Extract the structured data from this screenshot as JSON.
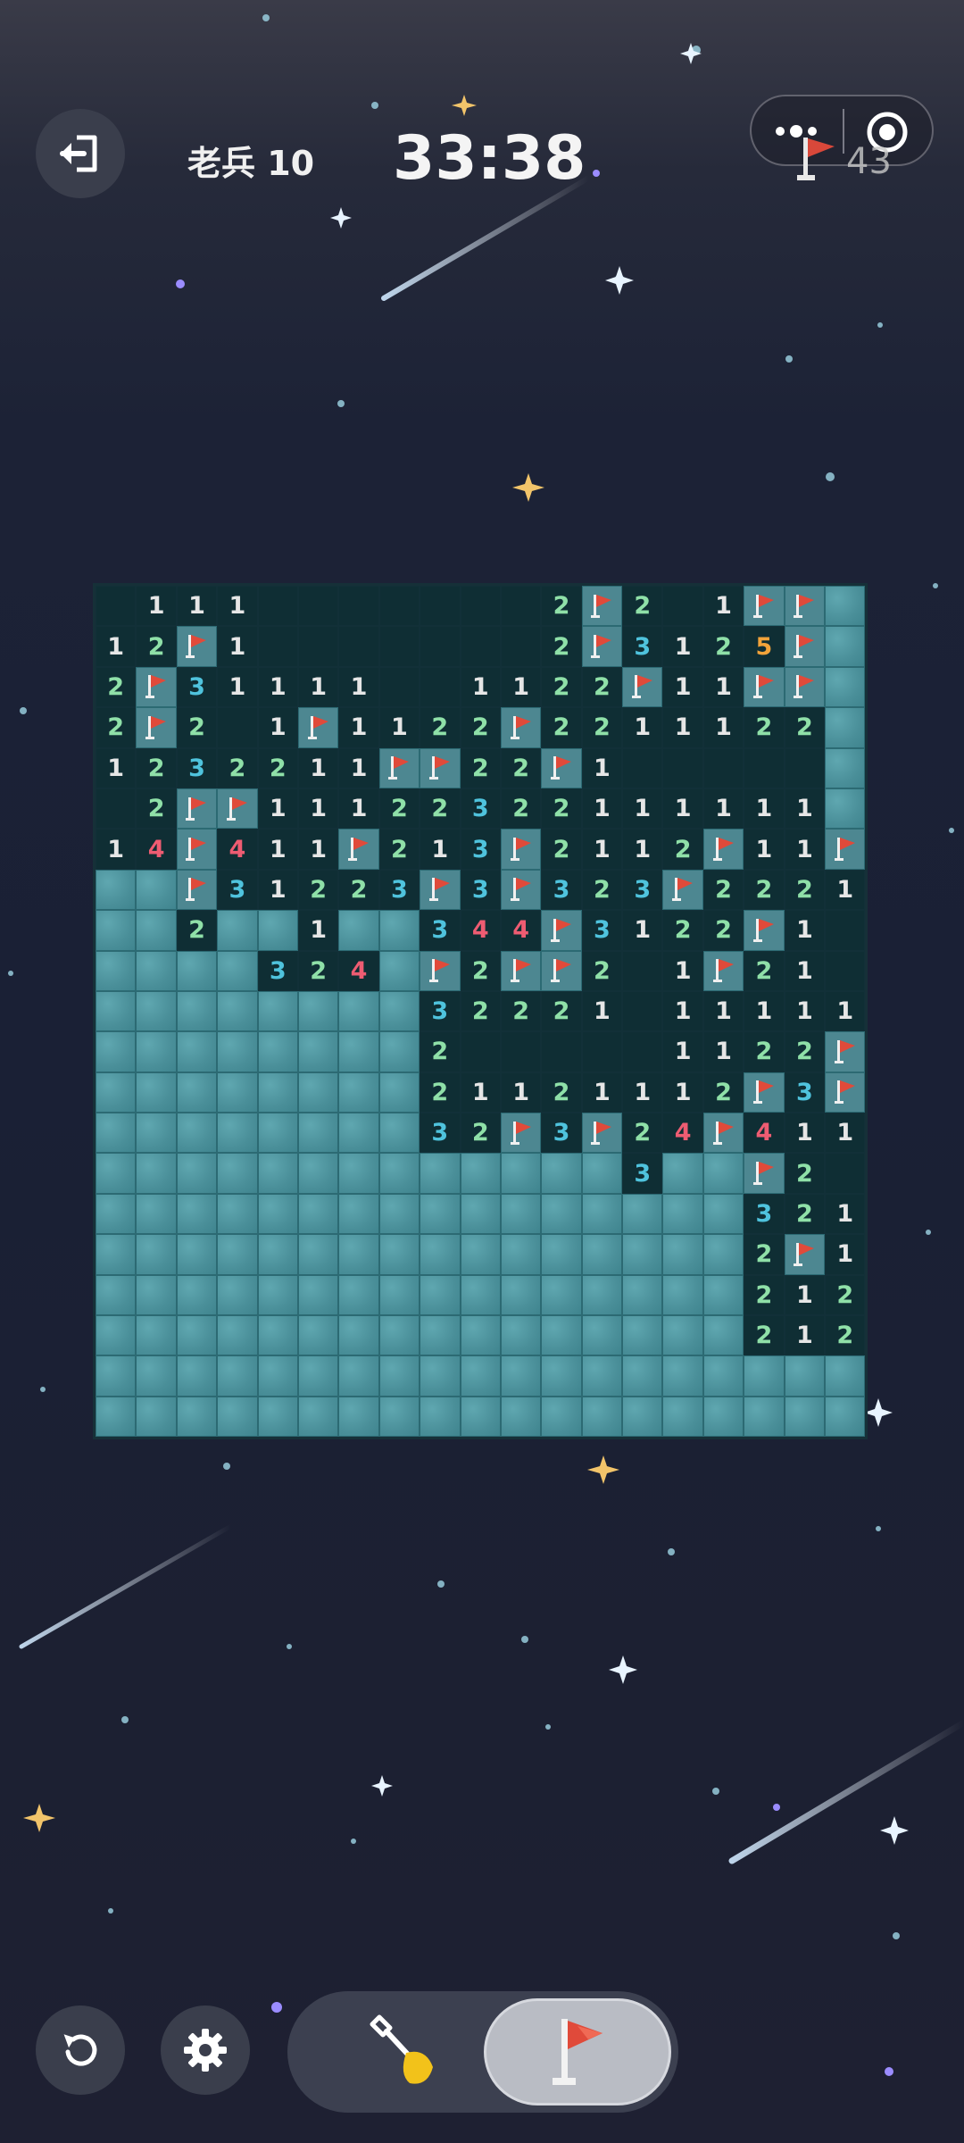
{
  "header": {
    "level_label": "老兵 10",
    "timer": "33:38",
    "flags_remaining": "43"
  },
  "icons": {
    "exit": "exit-icon",
    "more": "more-dots-icon",
    "target": "target-icon",
    "flag": "flag-icon",
    "restart": "restart-icon",
    "settings": "gear-icon",
    "dig": "shovel-icon"
  },
  "colors": {
    "number_1": "#e6e6e6",
    "number_2": "#8fe0a8",
    "number_3": "#4fc3dd",
    "number_4": "#ee5c72",
    "number_5": "#f2a33a",
    "flag_red": "#e04a3a"
  },
  "board": {
    "cols": 19,
    "legend": "H = unrevealed, F = flag, . = revealed empty, digit = revealed number",
    "rows": [
      ".111.......2F2.1FF",
      "12F1.......2F3125F",
      "2F31111..1122F11FF",
      "2F2.1F1122F2211122",
      "1232211FF22F1.....",
      ".2FF11122322111111",
      "14F411F213F2112F11F",
      "HHF31223F3F323F2221",
      "HH2HH1HH344F3122F1.",
      "HHHH324HF2FF2.1F21.",
      "HHHHHHHH32221.11111",
      "HHHHHHHH2.....1122F",
      "HHHHHHHH21121112F3F2",
      "HHHHHHHH32F3F24F411",
      "HHHHHHHHHHHHH3HHF2..",
      "HHHHHHHHHHHHHHHH321.",
      "HHHHHHHHHHHHHHHH2F1.",
      "HHHHHHHHHHHHHHHH2121",
      "HHHHHHHHHHHHHHHH212F",
      "HHHHHHHHHHHHHHHHHHHH",
      "HHHHHHHHHHHHHHHHHHHH"
    ]
  }
}
